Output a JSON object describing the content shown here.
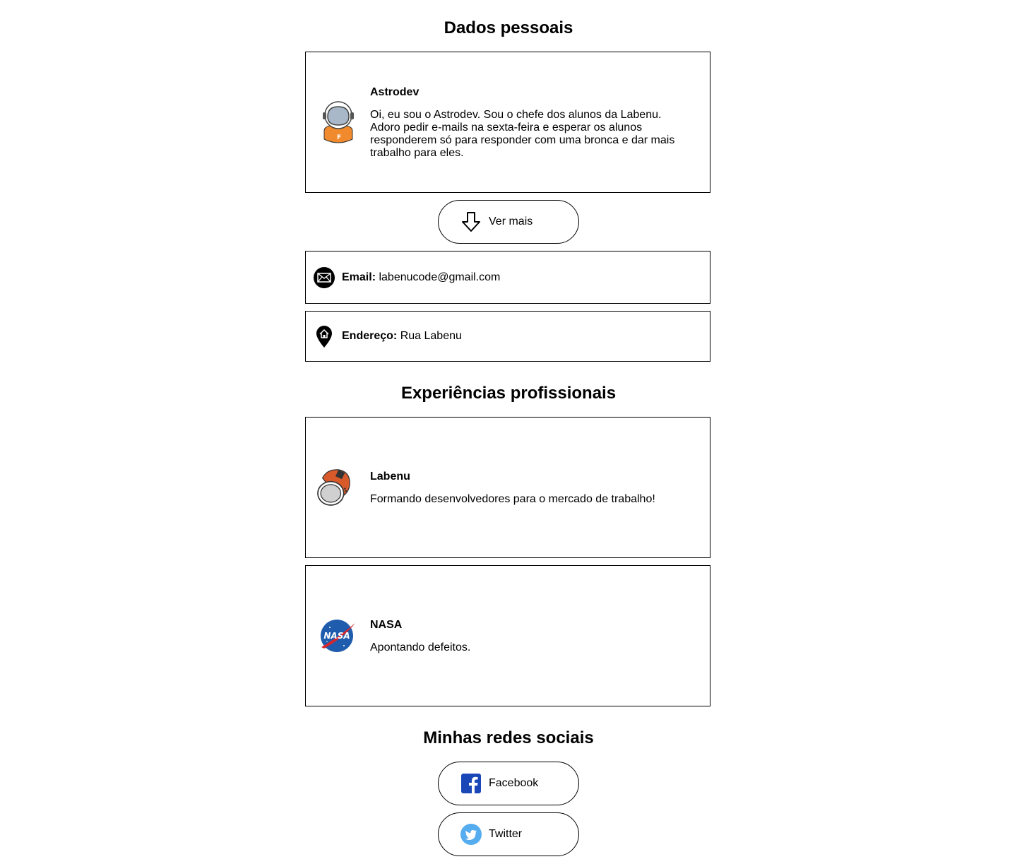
{
  "sections": {
    "personal_title": "Dados pessoais",
    "experience_title": "Experiências profissionais",
    "social_title": "Minhas redes sociais"
  },
  "profile": {
    "name": "Astrodev",
    "description": "Oi, eu sou o Astrodev. Sou o chefe dos alunos da Labenu. Adoro pedir e-mails na sexta-feira e esperar os alunos responderem só para responder com uma bronca e dar mais trabalho para eles.",
    "avatar_icon": "astronaut-avatar-icon"
  },
  "see_more_button": {
    "label": "Ver mais",
    "icon": "arrow-down-icon"
  },
  "contact": {
    "email": {
      "label": "Email:",
      "value": "labenucode@gmail.com",
      "icon": "envelope-icon"
    },
    "address": {
      "label": "Endereço:",
      "value": "Rua Labenu",
      "icon": "map-pin-home-icon"
    }
  },
  "experiences": [
    {
      "name": "Labenu",
      "description": "Formando desenvolvedores para o mercado de trabalho!",
      "icon": "astronaut-helmet-icon"
    },
    {
      "name": "NASA",
      "description": "Apontando defeitos.",
      "icon": "nasa-logo-icon",
      "logo_text": "NASA"
    }
  ],
  "social": [
    {
      "label": "Facebook",
      "icon": "facebook-icon",
      "color": "#1a47b8"
    },
    {
      "label": "Twitter",
      "icon": "twitter-icon",
      "color": "#55acee"
    }
  ],
  "colors": {
    "border": "#000000",
    "astronaut_orange": "#f08a2c",
    "helmet_orange": "#d85a2a",
    "nasa_blue": "#1f5cad",
    "nasa_red": "#d9262c"
  }
}
